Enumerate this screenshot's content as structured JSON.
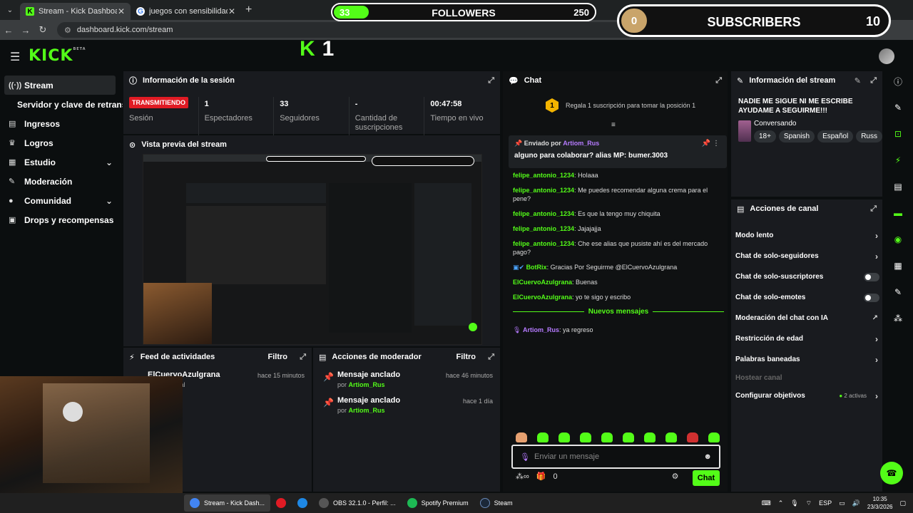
{
  "browser": {
    "tabs": [
      {
        "title": "Stream - Kick Dashboard",
        "active": true,
        "favicon": "K"
      },
      {
        "title": "juegos con sensibilidad de mic",
        "active": false,
        "favicon": "G"
      }
    ],
    "url": "dashboard.kick.com/stream"
  },
  "overlay": {
    "followers": {
      "current": "33",
      "label": "FOLLOWERS",
      "goal": "250",
      "progress": 0.132
    },
    "subscribers": {
      "current": "0",
      "label": "SUBSCRIBERS",
      "goal": "10"
    },
    "big_count": "1"
  },
  "header": {
    "logo": "KICK",
    "logo_badge": "BETA"
  },
  "sidebar": {
    "items": [
      {
        "label": "Stream",
        "icon": "broadcast-icon"
      },
      {
        "label": "Servidor y clave de retransmisión",
        "icon": ""
      },
      {
        "label": "Ingresos",
        "icon": "chart-icon"
      },
      {
        "label": "Logros",
        "icon": "trophy-icon"
      },
      {
        "label": "Estudio",
        "icon": "studio-icon"
      },
      {
        "label": "Moderación",
        "icon": "wrench-icon"
      },
      {
        "label": "Comunidad",
        "icon": "community-icon"
      },
      {
        "label": "Drops y recompensas",
        "icon": "drops-icon"
      }
    ]
  },
  "session": {
    "title": "Información de la sesión",
    "status": "TRANSMITIENDO",
    "status_label": "Sesión",
    "stats": [
      {
        "value": "1",
        "label": "Espectadores"
      },
      {
        "value": "33",
        "label": "Seguidores"
      },
      {
        "value": "-",
        "label": "Cantidad de suscripciones"
      },
      {
        "value": "00:47:58",
        "label": "Tiempo en vivo"
      }
    ]
  },
  "preview": {
    "title": "Vista previa del stream"
  },
  "activity": {
    "title": "Feed de actividades",
    "filter": "Filtro",
    "items": [
      {
        "user": "ElCuervoAzulgrana",
        "text": "…uir el canal",
        "ago": "hace 15 minutos"
      }
    ]
  },
  "modactions": {
    "title": "Acciones de moderador",
    "filter": "Filtro",
    "items": [
      {
        "title": "Mensaje anclado",
        "by_prefix": "por",
        "by": "Artiom_Rus",
        "ago": "hace 46 minutos"
      },
      {
        "title": "Mensaje anclado",
        "by_prefix": "por",
        "by": "Artiom_Rus",
        "ago": "hace 1 día"
      }
    ]
  },
  "chat": {
    "title": "Chat",
    "gift": {
      "count": "1",
      "text": "Regala 1 suscripción para tomar la posición 1"
    },
    "pinned": {
      "by_label": "Enviado por",
      "by": "Artiom_Rus",
      "message": "alguno para colaborar? alias MP: bumer.3003"
    },
    "messages": [
      {
        "user": "felipe_antonio_1234",
        "color": "#53fc18",
        "text": "Holaaa"
      },
      {
        "user": "felipe_antonio_1234",
        "color": "#53fc18",
        "text": "Me puedes recomendar alguna crema para el pene?"
      },
      {
        "user": "felipe_antonio_1234",
        "color": "#53fc18",
        "text": "Es que la tengo muy chiquita"
      },
      {
        "user": "felipe_antonio_1234",
        "color": "#53fc18",
        "text": "Jajajajja"
      },
      {
        "user": "felipe_antonio_1234",
        "color": "#53fc18",
        "text": "Che ese alias que pusiste ahí es del mercado pago?"
      },
      {
        "user": "BotRix",
        "color": "#53fc18",
        "text": "Gracias Por Seguirme @ElCuervoAzulgrana"
      },
      {
        "user": "ElCuervoAzulgrana",
        "color": "#53fc18",
        "text": "Buenas"
      },
      {
        "user": "ElCuervoAzulgrana",
        "color": "#53fc18",
        "text": "yo te sigo y escribo"
      }
    ],
    "new_label": "Nuevos mensajes",
    "new_messages": [
      {
        "user": "Artiom_Rus",
        "color": "#b67bff",
        "text": "ya regreso"
      }
    ],
    "input_placeholder": "Enviar un mensaje",
    "points": "0",
    "send_label": "Chat"
  },
  "streaminfo": {
    "title": "Información del stream",
    "stream_title": "NADIE ME SIGUE NI ME ESCRIBE AYUDAME A SEGUIRME!!!",
    "category": "Conversando",
    "tags": [
      "18+",
      "Spanish",
      "Español",
      "Russ"
    ]
  },
  "channel": {
    "title": "Acciones de canal",
    "actions": [
      {
        "label": "Modo lento",
        "kind": "chevron"
      },
      {
        "label": "Chat de solo-seguidores",
        "kind": "chevron"
      },
      {
        "label": "Chat de solo-suscriptores",
        "kind": "toggle"
      },
      {
        "label": "Chat de solo-emotes",
        "kind": "toggle"
      },
      {
        "label": "Moderación del chat con IA",
        "kind": "external"
      },
      {
        "label": "Restricción de edad",
        "kind": "chevron"
      },
      {
        "label": "Palabras baneadas",
        "kind": "chevron"
      },
      {
        "label": "Hostear canal",
        "kind": "disabled"
      },
      {
        "label": "Configurar objetivos",
        "kind": "chevron",
        "extra": "2 activas"
      }
    ]
  },
  "taskbar": {
    "items": [
      {
        "label": "Stream - Kick Dash...",
        "color": "#4285f4",
        "active": true
      },
      {
        "label": "",
        "color": "#e01b24",
        "active": false
      },
      {
        "label": "",
        "color": "#1e88e5",
        "active": false
      },
      {
        "label": "OBS 32.1.0 - Perfil: ...",
        "color": "#444",
        "active": false
      },
      {
        "label": "Spotify Premium",
        "color": "#1db954",
        "active": false
      },
      {
        "label": "Steam",
        "color": "#1b2838",
        "active": false
      }
    ],
    "lang": "ESP",
    "time": "10:35",
    "date": "23/3/2026"
  }
}
